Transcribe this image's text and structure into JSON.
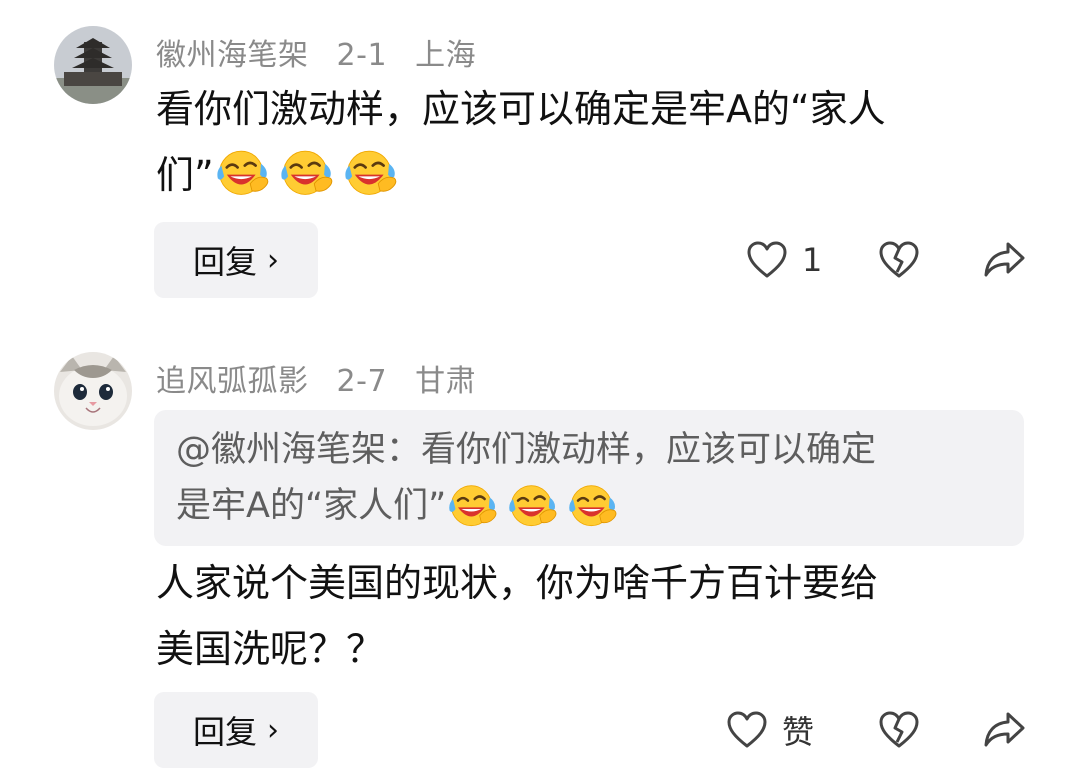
{
  "comments": [
    {
      "author": "徽州海笔架",
      "date": "2-1",
      "location": "上海",
      "text_line1": "看你们激动样，应该可以确定是牢A的“家人",
      "text_line2": "们”",
      "reply_label": "回复",
      "like_count": "1",
      "emojis": [
        "laughing-crying-emoji",
        "laughing-crying-emoji",
        "laughing-crying-emoji"
      ]
    },
    {
      "author": "追风弧孤影",
      "date": "2-7",
      "location": "甘肃",
      "quote_line1": "@徽州海笔架：看你们激动样，应该可以确定",
      "quote_line2": "是牢A的“家人们”",
      "text_line1": "人家说个美国的现状，你为啥千方百计要给",
      "text_line2": "美国洗呢？？",
      "reply_label": "回复",
      "like_label": "赞",
      "emojis": [
        "laughing-crying-emoji",
        "laughing-crying-emoji",
        "laughing-crying-emoji"
      ]
    }
  ],
  "colors": {
    "meta_text": "#8a8a8a",
    "quote_bg": "#f2f2f4",
    "button_bg": "#f2f2f4",
    "icon_stroke": "#444444"
  },
  "icons": {
    "chevron": "›",
    "like": "heart-outline-icon",
    "dislike": "broken-heart-icon",
    "share": "share-arrow-icon"
  }
}
